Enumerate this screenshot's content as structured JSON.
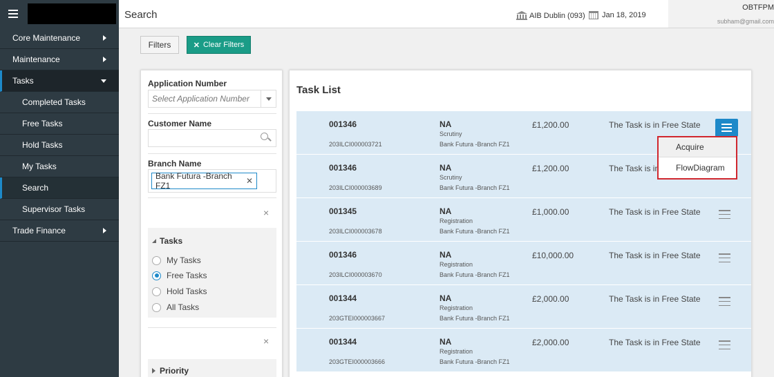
{
  "sidebar": {
    "items": [
      {
        "label": "Core Maintenance"
      },
      {
        "label": "Maintenance"
      },
      {
        "label": "Tasks"
      },
      {
        "label": "Trade Finance"
      }
    ],
    "sub_items": [
      {
        "label": "Completed Tasks"
      },
      {
        "label": "Free Tasks"
      },
      {
        "label": "Hold Tasks"
      },
      {
        "label": "My Tasks"
      },
      {
        "label": "Search"
      },
      {
        "label": "Supervisor Tasks"
      }
    ]
  },
  "header": {
    "title": "Search",
    "branch": "AIB Dublin (093)",
    "date": "Jan 18, 2019",
    "user_name": "OBTFPM",
    "user_email": "subham@gmail.com"
  },
  "toolbar": {
    "filters_label": "Filters",
    "clear_filters_label": "Clear Filters"
  },
  "filters": {
    "application_number_label": "Application Number",
    "application_number_placeholder": "Select Application Number",
    "customer_name_label": "Customer Name",
    "branch_name_label": "Branch Name",
    "branch_tag": "Bank Futura -Branch FZ1",
    "close_glyph": "×",
    "tasks_group_title": "Tasks",
    "task_options": [
      "My Tasks",
      "Free Tasks",
      "Hold Tasks",
      "All Tasks"
    ],
    "selected_task_option": "Free Tasks",
    "priority_group_title": "Priority"
  },
  "task_list": {
    "title": "Task List",
    "rows": [
      {
        "number": "001346",
        "reference": "203ILCI000003721",
        "na": "NA",
        "stage": "Scrutiny",
        "branch": "Bank Futura -Branch FZ1",
        "amount": "£1,200.00",
        "status": "The Task is in Free State"
      },
      {
        "number": "001346",
        "reference": "203ILCI000003689",
        "na": "NA",
        "stage": "Scrutiny",
        "branch": "Bank Futura -Branch FZ1",
        "amount": "£1,200.00",
        "status": "The Task is in Free State"
      },
      {
        "number": "001345",
        "reference": "203ILCI000003678",
        "na": "NA",
        "stage": "Registration",
        "branch": "Bank Futura -Branch FZ1",
        "amount": "£1,000.00",
        "status": "The Task is in Free State"
      },
      {
        "number": "001346",
        "reference": "203ILCI000003670",
        "na": "NA",
        "stage": "Registration",
        "branch": "Bank Futura -Branch FZ1",
        "amount": "£10,000.00",
        "status": "The Task is in Free State"
      },
      {
        "number": "001344",
        "reference": "203GTEI000003667",
        "na": "NA",
        "stage": "Registration",
        "branch": "Bank Futura -Branch FZ1",
        "amount": "£2,000.00",
        "status": "The Task is in Free State"
      },
      {
        "number": "001344",
        "reference": "203GTEI000003666",
        "na": "NA",
        "stage": "Registration",
        "branch": "Bank Futura -Branch FZ1",
        "amount": "£2,000.00",
        "status": "The Task is in Free State"
      }
    ]
  },
  "popup_menu": {
    "items": [
      "Acquire",
      "FlowDiagram"
    ]
  },
  "colors": {
    "sidebar_bg": "#2e3b43",
    "accent_blue": "#1d89c9",
    "clear_filters_green": "#1a9c87",
    "row_bg": "#dbeaf5",
    "popup_border": "#d0262d"
  }
}
